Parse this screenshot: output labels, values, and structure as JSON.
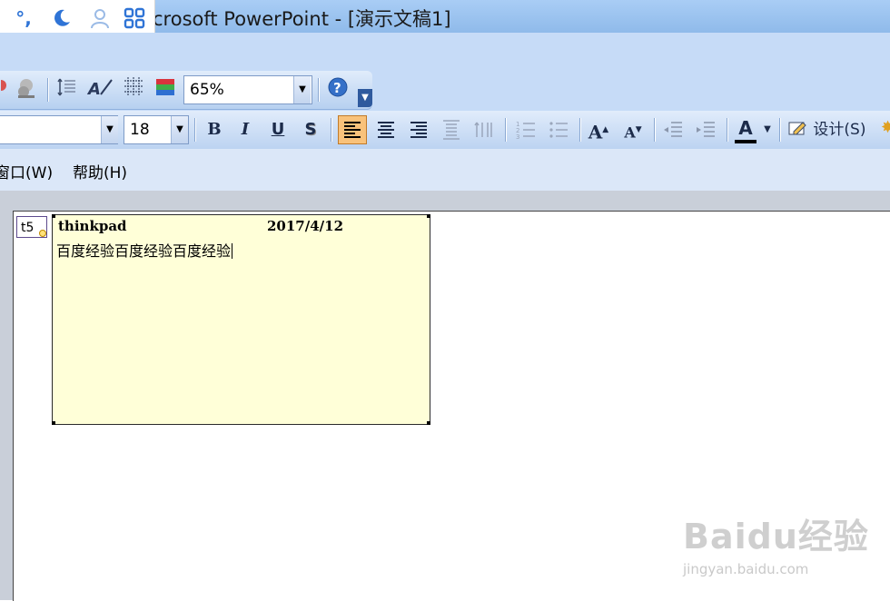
{
  "window": {
    "title": "crosoft PowerPoint - [演示文稿1]"
  },
  "ime": {
    "icons": [
      "degree-comma-icon",
      "moon-icon",
      "user-icon",
      "grid-icon"
    ]
  },
  "toolbar1": {
    "zoom_value": "65%",
    "buttons": [
      "color-icon",
      "chart-icon",
      "expand-icon",
      "text-direction-icon",
      "grid-icon",
      "color-scheme-icon",
      "help-icon",
      "overflow-icon"
    ]
  },
  "toolbar2": {
    "font_name": "",
    "font_size": "18",
    "bold": "B",
    "italic": "I",
    "underline": "U",
    "shadow": "S",
    "grow_font": "A",
    "shrink_font": "A",
    "font_color": "A",
    "design_label": "设计(S)"
  },
  "menubar": {
    "items": [
      "窗口(W)",
      "帮助(H)"
    ]
  },
  "comment": {
    "marker": "t5",
    "author": "thinkpad",
    "date": "2017/4/12",
    "body": "百度经验百度经验百度经验"
  },
  "watermark": {
    "logo": "Baidu经验",
    "url": "jingyan.baidu.com"
  },
  "colors": {
    "title_bar": "#a9cdf5",
    "toolbar": "#c6dbf7",
    "note_bg": "#ffffd8",
    "active_align": "#f9c27b"
  }
}
